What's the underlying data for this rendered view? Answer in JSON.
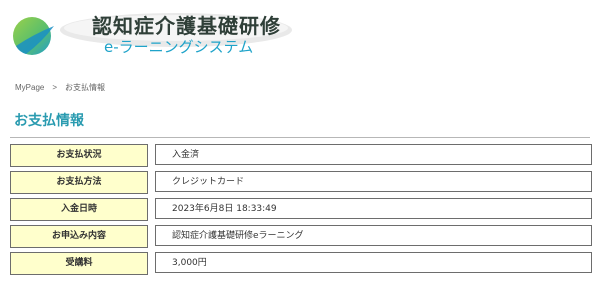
{
  "header": {
    "title": "認知症介護基礎研修",
    "subtitle": "e-ラーニングシステム"
  },
  "breadcrumb": {
    "home": "MyPage",
    "separator": ">",
    "current": "お支払情報"
  },
  "page_title": "お支払情報",
  "payment_info": [
    {
      "label": "お支払状況",
      "value": "入金済"
    },
    {
      "label": "お支払方法",
      "value": "クレジットカード"
    },
    {
      "label": "入金日時",
      "value": "2023年6月8日 18:33:49"
    },
    {
      "label": "お申込み内容",
      "value": "認知症介護基礎研修eラーニング"
    },
    {
      "label": "受講料",
      "value": "3,000円"
    }
  ],
  "colors": {
    "title_accent": "#2a9bb0",
    "label_background": "#ffffcc",
    "border": "#6d6d6d",
    "logo_green": "#8cc63f",
    "logo_blue": "#1fa3c9"
  }
}
